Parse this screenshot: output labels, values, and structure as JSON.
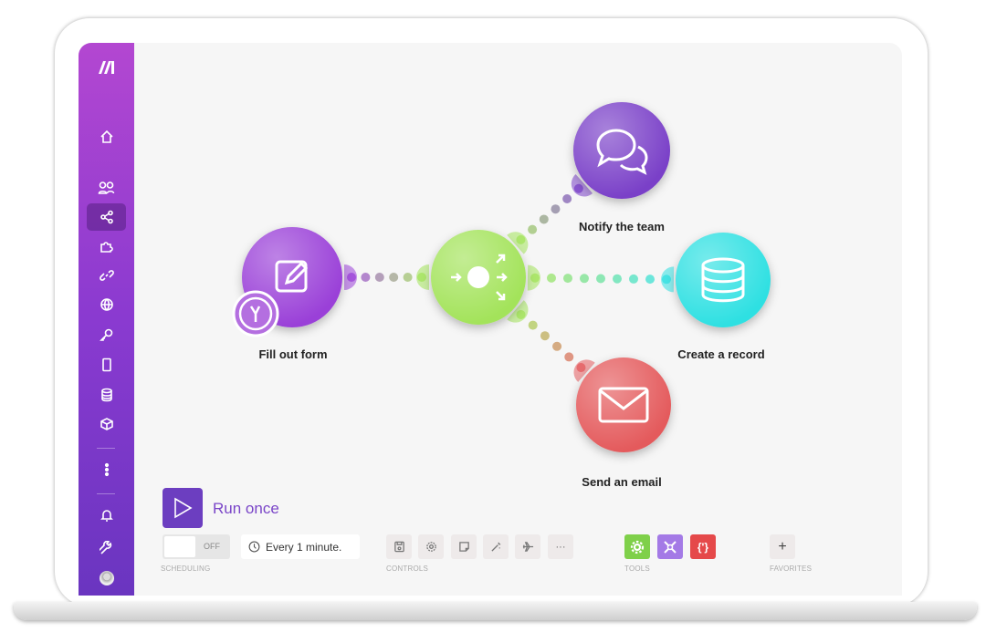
{
  "sidebar": {
    "logo": "make-logo",
    "items": [
      {
        "name": "home",
        "icon": "home-icon"
      },
      {
        "name": "team",
        "icon": "users-icon"
      },
      {
        "name": "scenarios",
        "icon": "share-icon",
        "active": true
      },
      {
        "name": "templates",
        "icon": "puzzle-icon"
      },
      {
        "name": "connections",
        "icon": "link-icon"
      },
      {
        "name": "webhooks",
        "icon": "globe-icon"
      },
      {
        "name": "keys",
        "icon": "key-icon"
      },
      {
        "name": "devices",
        "icon": "phone-icon"
      },
      {
        "name": "data-stores",
        "icon": "database-icon"
      },
      {
        "name": "data-structures",
        "icon": "cube-icon"
      },
      {
        "name": "more",
        "icon": "more-icon"
      },
      {
        "name": "notifications",
        "icon": "bell-icon"
      },
      {
        "name": "resources",
        "icon": "wrench-icon"
      },
      {
        "name": "profile",
        "icon": "avatar-icon"
      }
    ]
  },
  "canvas": {
    "nodes": [
      {
        "label": "Fill out form",
        "color": "#9a40d8",
        "icon": "edit-icon"
      },
      {
        "label": "",
        "color": "#a3e35a",
        "icon": "router-icon"
      },
      {
        "label": "Notify the team",
        "color": "#7a3fc8",
        "icon": "chat-icon"
      },
      {
        "label": "Create a record",
        "color": "#2fe0e2",
        "icon": "database-icon"
      },
      {
        "label": "Send an email",
        "color": "#e45a5c",
        "icon": "mail-icon"
      }
    ]
  },
  "toolbar": {
    "run_label": "Run once",
    "toggle_label": "OFF",
    "schedule": "Every 1 minute.",
    "sections": {
      "scheduling": "SCHEDULING",
      "controls": "CONTROLS",
      "tools": "TOOLS",
      "favorites": "FAVORITES"
    },
    "controls_more": "···",
    "favorites_add": "+",
    "tool_text": "{'}",
    "tool_colors": [
      "#7fd04a",
      "#a47ae6",
      "#e5494a"
    ]
  }
}
